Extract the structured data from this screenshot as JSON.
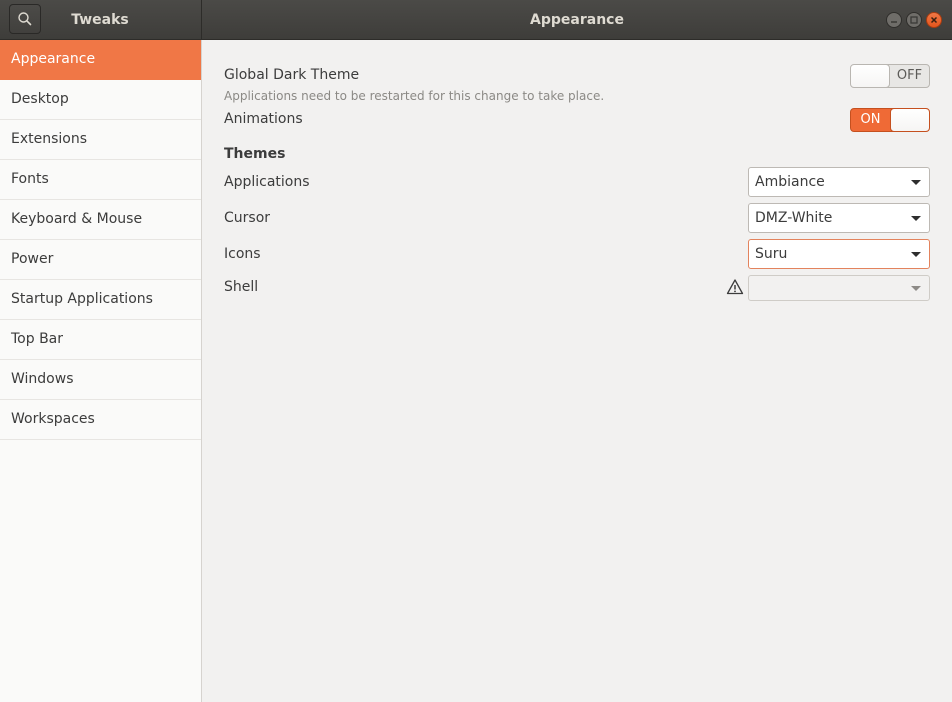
{
  "app": {
    "title": "Tweaks",
    "window_title": "Appearance",
    "accent_color": "#f07746"
  },
  "header": {
    "search_icon": "search-icon",
    "window_controls": [
      "minimize-icon",
      "maximize-icon",
      "close-icon"
    ]
  },
  "sidebar": {
    "selected_index": 0,
    "items": [
      {
        "label": "Appearance"
      },
      {
        "label": "Desktop"
      },
      {
        "label": "Extensions"
      },
      {
        "label": "Fonts"
      },
      {
        "label": "Keyboard & Mouse"
      },
      {
        "label": "Power"
      },
      {
        "label": "Startup Applications"
      },
      {
        "label": "Top Bar"
      },
      {
        "label": "Windows"
      },
      {
        "label": "Workspaces"
      }
    ]
  },
  "main": {
    "dark_theme": {
      "label": "Global Dark Theme",
      "subtitle": "Applications need to be restarted for this change to take place.",
      "state": "OFF"
    },
    "animations": {
      "label": "Animations",
      "state": "ON"
    },
    "themes": {
      "heading": "Themes",
      "applications": {
        "label": "Applications",
        "value": "Ambiance"
      },
      "cursor": {
        "label": "Cursor",
        "value": "DMZ-White"
      },
      "icons": {
        "label": "Icons",
        "value": "Suru"
      },
      "shell": {
        "label": "Shell",
        "value": "",
        "warning_icon": "warning-icon"
      }
    }
  }
}
